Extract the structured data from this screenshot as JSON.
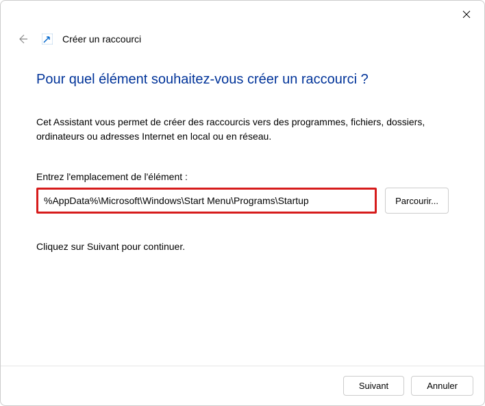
{
  "titlebar": {
    "close": "Close"
  },
  "header": {
    "title": "Créer un raccourci"
  },
  "heading": "Pour quel élément souhaitez-vous créer un raccourci ?",
  "description": "Cet Assistant vous permet de créer des raccourcis vers des programmes, fichiers, dossiers, ordinateurs ou adresses Internet en local ou en réseau.",
  "field": {
    "label": "Entrez l'emplacement de l'élément :",
    "value": "%AppData%\\Microsoft\\Windows\\Start Menu\\Programs\\Startup",
    "browse": "Parcourir..."
  },
  "continue_text": "Cliquez sur Suivant pour continuer.",
  "footer": {
    "next": "Suivant",
    "cancel": "Annuler"
  }
}
